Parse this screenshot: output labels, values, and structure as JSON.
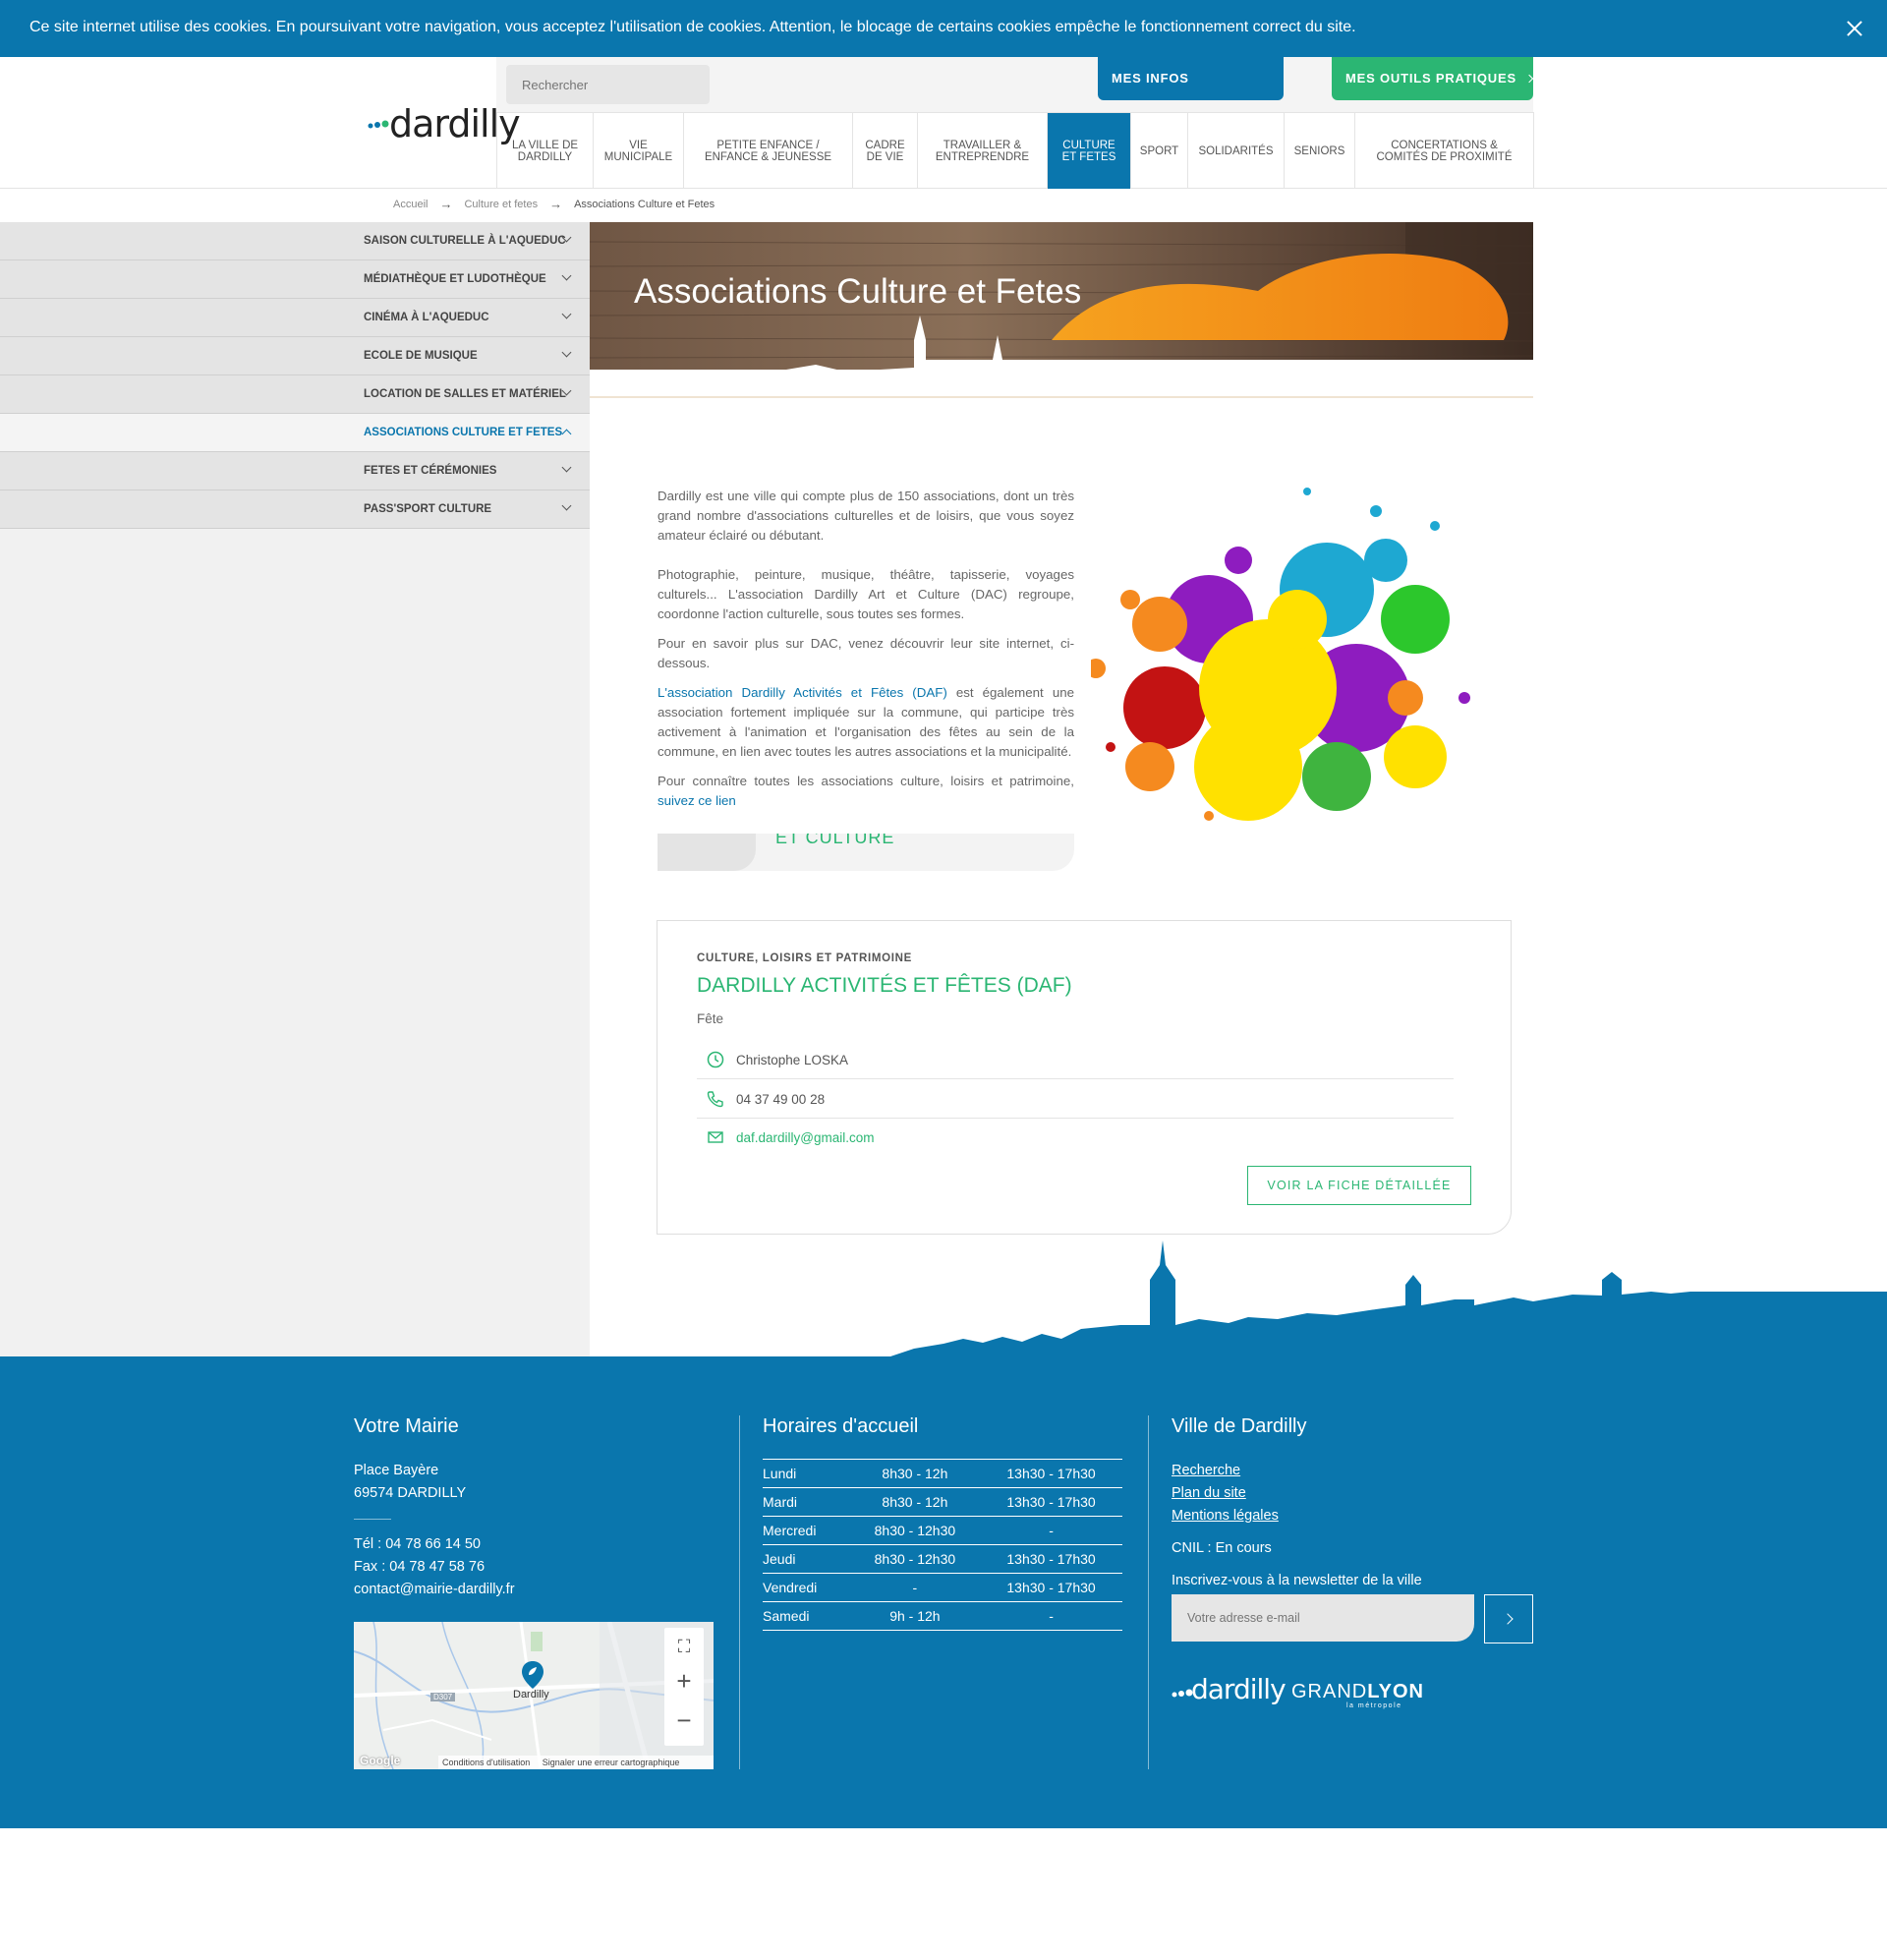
{
  "cookie": {
    "text": "Ce site internet utilise des cookies. En poursuivant votre navigation, vous acceptez l'utilisation de cookies. Attention, le blocage de certains cookies empêche le fonctionnement correct du site."
  },
  "header": {
    "logo_text": "dardilly",
    "search_placeholder": "Rechercher",
    "btn_infos": "MES INFOS QUOTIDIENNES",
    "btn_outils": "MES OUTILS PRATIQUES",
    "nav": [
      {
        "label": "LA VILLE DE DARDILLY"
      },
      {
        "label": "VIE MUNICIPALE"
      },
      {
        "label": "PETITE ENFANCE / ENFANCE & JEUNESSE"
      },
      {
        "label": "CADRE DE VIE"
      },
      {
        "label": "TRAVAILLER & ENTREPRENDRE"
      },
      {
        "label": "CULTURE ET FETES"
      },
      {
        "label": "SPORT"
      },
      {
        "label": "SOLIDARITÉS"
      },
      {
        "label": "SENIORS"
      },
      {
        "label": "CONCERTATIONS & COMITÉS DE PROXIMITÉ"
      }
    ]
  },
  "breadcrumb": [
    "Accueil",
    "Culture et fetes",
    "Associations Culture et Fetes"
  ],
  "sidebar": [
    {
      "label": "SAISON CULTURELLE À L'AQUEDUC"
    },
    {
      "label": "MÉDIATHÈQUE ET LUDOTHÈQUE"
    },
    {
      "label": "CINÉMA À L'AQUEDUC"
    },
    {
      "label": "ECOLE DE MUSIQUE"
    },
    {
      "label": "LOCATION DE SALLES ET MATÉRIEL"
    },
    {
      "label": "ASSOCIATIONS CULTURE ET FETES"
    },
    {
      "label": "FETES ET CÉRÉMONIES"
    },
    {
      "label": "PASS'SPORT CULTURE"
    }
  ],
  "page": {
    "title": "Associations Culture et Fetes",
    "p1": "Dardilly est une ville qui compte plus de 150 associations, dont un très grand nombre d'associations culturelles et de loisirs, que vous soyez amateur éclairé ou débutant.",
    "p2": "Photographie, peinture, musique, théâtre, tapisserie, voyages culturels... L'association Dardilly Art et Culture (DAC) regroupe, coordonne l'action culturelle, sous toutes ses formes.",
    "p3": "Pour en savoir plus sur DAC, venez découvrir leur site internet, ci-dessous.",
    "p4_link": "L'association Dardilly Activités et Fêtes (DAF)",
    "p4_rest": " est également une association fortement impliquée sur la commune, qui participe très activement à l'animation et l'organisation des fêtes au sein de la commune, en lien avec toutes les autres associations et la municipalité.",
    "p5": "Pour connaître toutes les associations culture, loisirs et patrimoine, ",
    "p5_link": "suivez ce lien",
    "dac_partial": "ET CULTURE"
  },
  "card": {
    "category": "CULTURE, LOISIRS ET PATRIMOINE",
    "name": "DARDILLY ACTIVITÉS ET FÊTES (DAF)",
    "type": "Fête",
    "contact": "Christophe LOSKA",
    "phone": "04 37 49 00 28",
    "email": "daf.dardilly@gmail.com",
    "button": "VOIR LA FICHE DÉTAILLÉE"
  },
  "footer": {
    "mairie": {
      "title": "Votre Mairie",
      "addr1": "Place Bayère",
      "addr2": "69574 DARDILLY",
      "tel": "Tél : 04 78 66 14 50",
      "fax": "Fax : 04 78 47 58 76",
      "email": "contact@mairie-dardilly.fr",
      "map_label": "Dardilly",
      "map_road": "D307",
      "map_conditions": "Conditions d'utilisation",
      "map_report": "Signaler une erreur cartographique",
      "map_google": "Google"
    },
    "horaires": {
      "title": "Horaires d'accueil",
      "rows": [
        {
          "day": "Lundi",
          "am": "8h30 - 12h",
          "pm": "13h30 - 17h30"
        },
        {
          "day": "Mardi",
          "am": "8h30 - 12h",
          "pm": "13h30 - 17h30"
        },
        {
          "day": "Mercredi",
          "am": "8h30 - 12h30",
          "pm": "-"
        },
        {
          "day": "Jeudi",
          "am": "8h30 - 12h30",
          "pm": "13h30 - 17h30"
        },
        {
          "day": "Vendredi",
          "am": "-",
          "pm": "13h30 - 17h30"
        },
        {
          "day": "Samedi",
          "am": "9h - 12h",
          "pm": "-"
        }
      ]
    },
    "ville": {
      "title": "Ville de Dardilly",
      "links": [
        "Recherche",
        "Plan du site",
        "Mentions légales"
      ],
      "cnil": "CNIL : En cours",
      "newsletter_label": "Inscrivez-vous à la newsletter de la ville",
      "newsletter_placeholder": "Votre adresse e-mail",
      "logo_text": "dardilly",
      "grandlyon_a": "GRAND",
      "grandlyon_b": "LYON",
      "grandlyon_sub": "la métropole"
    }
  },
  "colors": {
    "blue": "#0a76ad",
    "green": "#2bb673"
  }
}
